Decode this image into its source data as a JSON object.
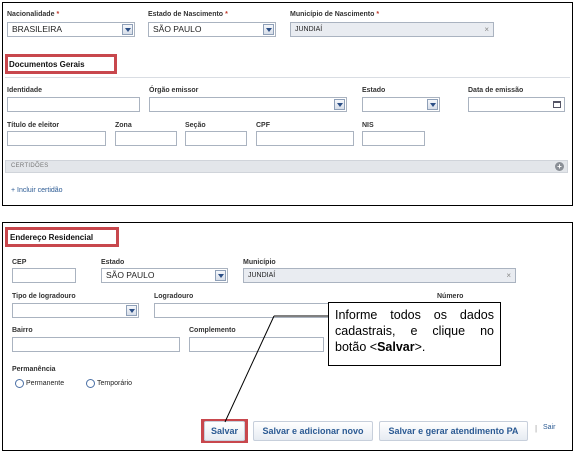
{
  "top_form": {
    "nacionalidade": {
      "label": "Nacionalidade",
      "value": "BRASILEIRA",
      "required": "*"
    },
    "estado_nascimento": {
      "label": "Estado de Nascimento",
      "value": "SÃO PAULO",
      "required": "*"
    },
    "municipio_nascimento": {
      "label": "Município de Nascimento",
      "value": "JUNDIAÍ",
      "required": "*",
      "clear": "×"
    }
  },
  "documentos": {
    "title": "Documentos Gerais",
    "identidade": "Identidade",
    "orgao_emissor": "Órgão emissor",
    "estado": "Estado",
    "data_emissao": "Data de emissão",
    "titulo_eleitor": "Título de eleitor",
    "zona": "Zona",
    "secao": "Seção",
    "cpf": "CPF",
    "nis": "NIS",
    "certidoes": "CERTIDÕES",
    "add_cert": "+ Incluir certidão"
  },
  "endereco": {
    "title": "Endereço Residencial",
    "cep": "CEP",
    "estado_label": "Estado",
    "estado_value": "SÃO PAULO",
    "municipio_label": "Município",
    "municipio_value": "JUNDIAÍ",
    "municipio_clear": "×",
    "tipo_logradouro": "Tipo de logradouro",
    "logradouro": "Logradouro",
    "numero": "Número",
    "bairro": "Bairro",
    "complemento": "Complemento",
    "permanencia": "Permanência",
    "permanente": "Permanente",
    "temporario": "Temporário"
  },
  "buttons": {
    "salvar": "Salvar",
    "salvar_novo": "Salvar e adicionar novo",
    "salvar_pa": "Salvar e gerar atendimento PA",
    "separator": "|",
    "sair": "Sair"
  },
  "callout": {
    "line1": "Informe todos os dados cadastrais, e clique no botão <",
    "bold": "Salvar",
    "line2": ">."
  },
  "colors": {
    "highlight": "#c8474d",
    "link": "#2b5a93",
    "required": "#c0392b"
  }
}
